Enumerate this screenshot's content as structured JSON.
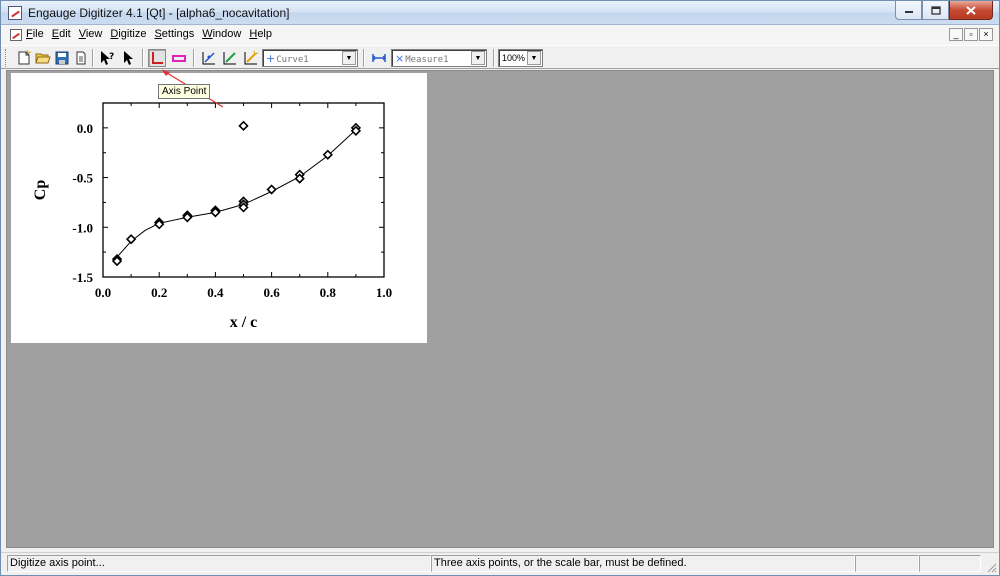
{
  "window": {
    "title": "Engauge Digitizer 4.1 [Qt] - [alpha6_nocavitation]",
    "controls": {
      "minimize": "0",
      "maximize": "1",
      "close": "r"
    }
  },
  "menu": {
    "items": [
      {
        "label": "File",
        "key": "F"
      },
      {
        "label": "Edit",
        "key": "E"
      },
      {
        "label": "View",
        "key": "V"
      },
      {
        "label": "Digitize",
        "key": "D"
      },
      {
        "label": "Settings",
        "key": "S"
      },
      {
        "label": "Window",
        "key": "W"
      },
      {
        "label": "Help",
        "key": "H"
      }
    ],
    "mdi": {
      "minimize": "_",
      "restore": "▫",
      "close": "×"
    }
  },
  "toolbar": {
    "curve_combo": {
      "value": "Curve1",
      "icon": "plus-icon"
    },
    "measure_combo": {
      "value": "Measure1",
      "icon": "cross-icon"
    },
    "zoom_combo": {
      "value": "100%"
    },
    "tooltip": "Axis Point",
    "icons": [
      "new-document-icon",
      "open-folder-icon",
      "save-icon",
      "print-icon",
      "whats-this-icon",
      "select-arrow-icon",
      "axis-point-icon",
      "scale-bar-icon",
      "point-match-icon",
      "curve-icon",
      "segment-fill-icon",
      "measure-icon"
    ]
  },
  "chart_data": {
    "type": "scatter",
    "xlabel": "x / c",
    "ylabel": "Cp",
    "xlim": [
      0.0,
      1.0
    ],
    "ylim": [
      -1.5,
      0.25
    ],
    "x_ticks": [
      "0.0",
      "0.2",
      "0.4",
      "0.6",
      "0.8",
      "1.0"
    ],
    "y_ticks": [
      "0.0",
      "-0.5",
      "-1.0",
      "-1.5"
    ],
    "points": [
      [
        0.05,
        -1.32
      ],
      [
        0.05,
        -1.34
      ],
      [
        0.1,
        -1.12
      ],
      [
        0.2,
        -0.95
      ],
      [
        0.2,
        -0.97
      ],
      [
        0.3,
        -0.88
      ],
      [
        0.3,
        -0.9
      ],
      [
        0.4,
        -0.83
      ],
      [
        0.4,
        -0.85
      ],
      [
        0.5,
        -0.74
      ],
      [
        0.5,
        -0.77
      ],
      [
        0.5,
        -0.8
      ],
      [
        0.5,
        0.02
      ],
      [
        0.6,
        -0.62
      ],
      [
        0.7,
        -0.47
      ],
      [
        0.7,
        -0.51
      ],
      [
        0.8,
        -0.27
      ],
      [
        0.9,
        0.0
      ],
      [
        0.9,
        -0.03
      ]
    ],
    "fit_line": [
      [
        0.05,
        -1.3
      ],
      [
        0.1,
        -1.14
      ],
      [
        0.15,
        -1.03
      ],
      [
        0.2,
        -0.96
      ],
      [
        0.3,
        -0.9
      ],
      [
        0.4,
        -0.85
      ],
      [
        0.5,
        -0.77
      ],
      [
        0.6,
        -0.64
      ],
      [
        0.7,
        -0.49
      ],
      [
        0.8,
        -0.28
      ],
      [
        0.9,
        -0.02
      ]
    ]
  },
  "status": {
    "left": "Digitize axis point...",
    "middle": "Three axis points, or the scale bar, must be defined.",
    "right1": "",
    "right2": ""
  },
  "colors": {
    "workspace": "#a0a0a0",
    "tooltip_bg": "#ffffe1",
    "axis_point_red": "#cc2020",
    "curve_blue": "#3b6fd8"
  }
}
